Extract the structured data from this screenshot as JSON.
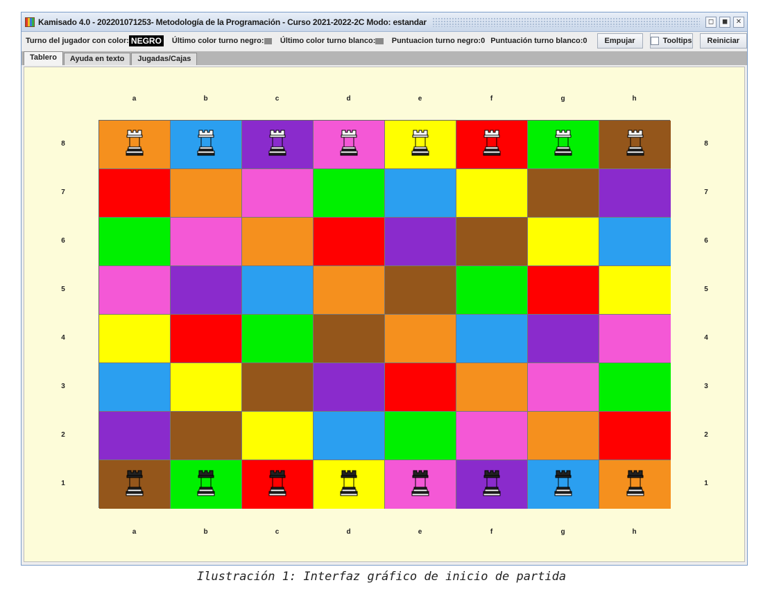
{
  "window": {
    "title": "Kamisado 4.0 - 202201071253- Metodología de la Programación - Curso 2021-2022-2C Modo: estandar"
  },
  "toolbar": {
    "turn_label": "Turno del jugador con color:",
    "turn_value": "NEGRO",
    "last_black_label": "Último color turno negro:",
    "last_white_label": "Último color turno blanco:",
    "score_black": "Puntuacion turno negro:0",
    "score_white": "Puntuación turno blanco:0",
    "push_button": "Empujar",
    "tooltips_label": "Tooltips",
    "tooltips_checked": false,
    "reset_button": "Reiniciar"
  },
  "tabs": [
    {
      "label": "Tablero",
      "active": true
    },
    {
      "label": "Ayuda en texto",
      "active": false
    },
    {
      "label": "Jugadas/Cajas",
      "active": false
    }
  ],
  "board": {
    "files": [
      "a",
      "b",
      "c",
      "d",
      "e",
      "f",
      "g",
      "h"
    ],
    "ranks": [
      "8",
      "7",
      "6",
      "5",
      "4",
      "3",
      "2",
      "1"
    ],
    "palette": {
      "orange": "#f5901e",
      "blue": "#2b9ff0",
      "purple": "#8a2bcc",
      "pink": "#f458d6",
      "yellow": "#ffff00",
      "red": "#ff0000",
      "green": "#00f000",
      "brown": "#94561b"
    },
    "rows": [
      [
        "orange",
        "blue",
        "purple",
        "pink",
        "yellow",
        "red",
        "green",
        "brown"
      ],
      [
        "red",
        "orange",
        "pink",
        "green",
        "blue",
        "yellow",
        "brown",
        "purple"
      ],
      [
        "green",
        "pink",
        "orange",
        "red",
        "purple",
        "brown",
        "yellow",
        "blue"
      ],
      [
        "pink",
        "purple",
        "blue",
        "orange",
        "brown",
        "green",
        "red",
        "yellow"
      ],
      [
        "yellow",
        "red",
        "green",
        "brown",
        "orange",
        "blue",
        "purple",
        "pink"
      ],
      [
        "blue",
        "yellow",
        "brown",
        "purple",
        "red",
        "orange",
        "pink",
        "green"
      ],
      [
        "purple",
        "brown",
        "yellow",
        "blue",
        "green",
        "pink",
        "orange",
        "red"
      ],
      [
        "brown",
        "green",
        "red",
        "yellow",
        "pink",
        "purple",
        "blue",
        "orange"
      ]
    ],
    "pieces": {
      "white_rank_index": 0,
      "black_rank_index": 7
    }
  },
  "caption": "Ilustración 1: Interfaz gráfico de inicio de partida"
}
